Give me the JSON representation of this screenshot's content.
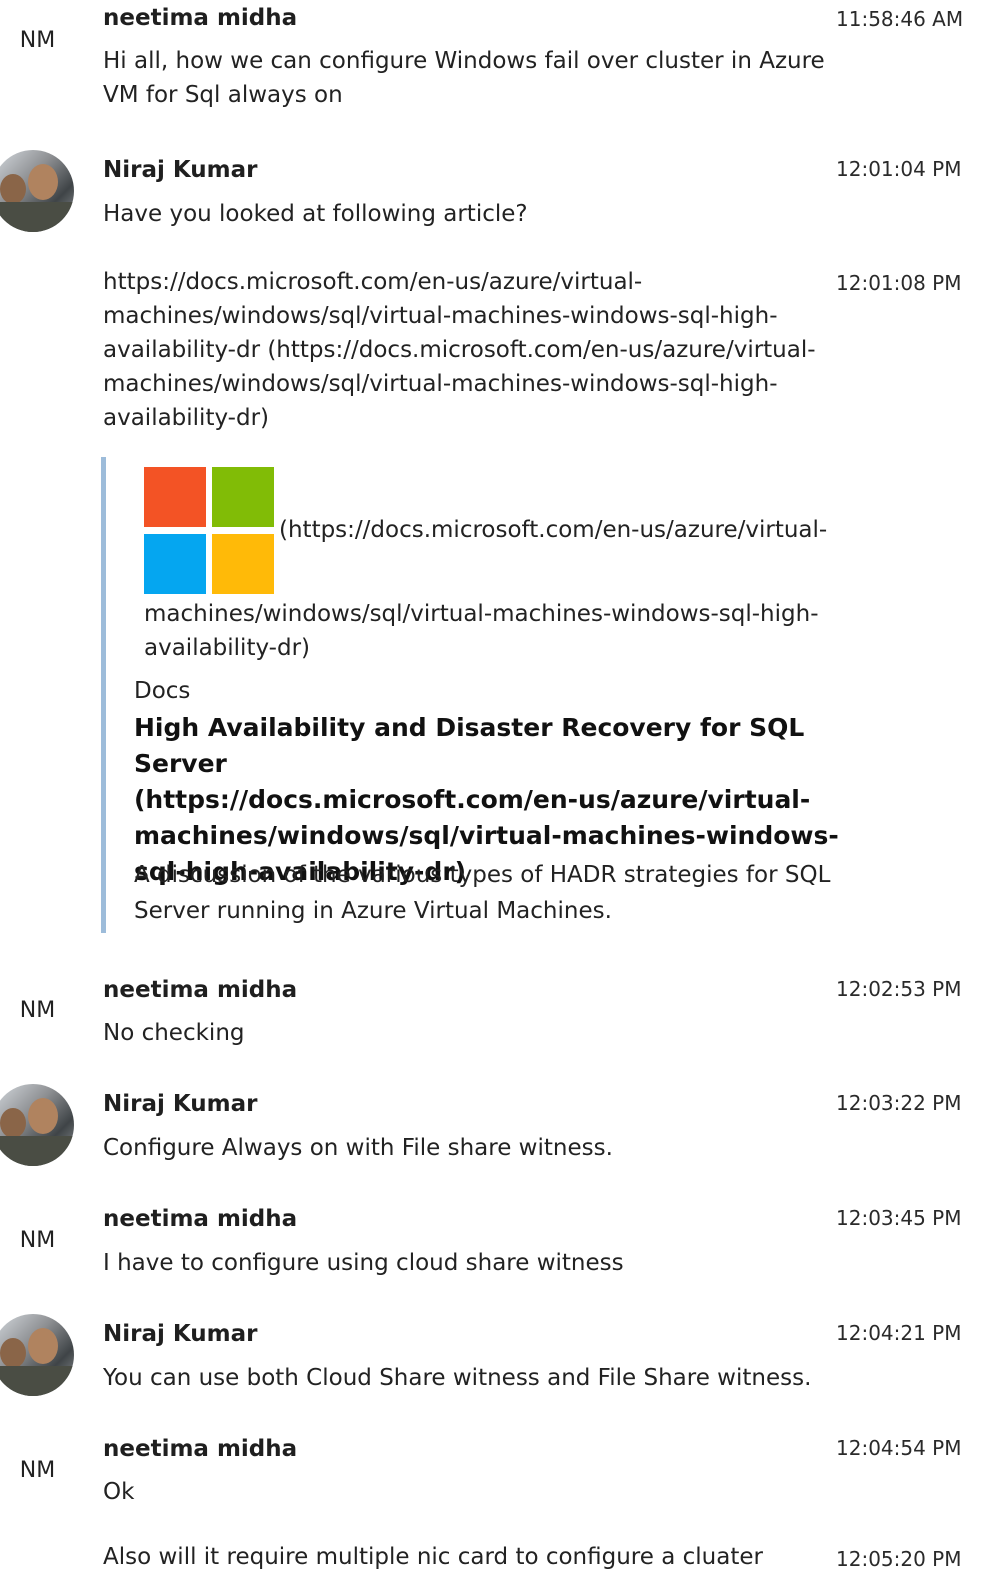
{
  "messages": [
    {
      "sender": "neetima midha",
      "initials": "NM",
      "time": "11:58:46 AM",
      "text": "Hi all,  how we can configure Windows fail over cluster in Azure\nVM for Sql always on"
    },
    {
      "sender": "Niraj Kumar",
      "avatar": "profile-photo",
      "time": "12:01:04 PM",
      "text": "Have you looked at following article?"
    },
    {
      "time": "12:01:08 PM",
      "text": "https://docs.microsoft.com/en-us/azure/virtual-\nmachines/windows/sql/virtual-machines-windows-sql-high-\navailability-dr (https://docs.microsoft.com/en-us/azure/virtual-\nmachines/windows/sql/virtual-machines-windows-sql-high-\navailability-dr)",
      "preview": {
        "logo": "microsoft-logo",
        "logo_colors": [
          "#f35325",
          "#81bc06",
          "#05a6f0",
          "#ffba08"
        ],
        "link_line1": "(https://docs.microsoft.com/en-us/azure/virtual-",
        "link_rest": "machines/windows/sql/virtual-machines-windows-sql-high-\navailability-dr)",
        "source": "Docs",
        "title": "High Availability and Disaster Recovery for SQL Server\n(https://docs.microsoft.com/en-us/azure/virtual-\nmachines/windows/sql/virtual-machines-windows-\nsql-high-availability-dr)",
        "description": "A discussion of the various types of HADR strategies for SQL\nServer running in Azure Virtual Machines."
      }
    },
    {
      "sender": "neetima midha",
      "initials": "NM",
      "time": "12:02:53 PM",
      "text": "No checking"
    },
    {
      "sender": "Niraj Kumar",
      "avatar": "profile-photo",
      "time": "12:03:22 PM",
      "text": "Configure Always on with File share witness."
    },
    {
      "sender": "neetima midha",
      "initials": "NM",
      "time": "12:03:45 PM",
      "text": "I have to configure using cloud share witness"
    },
    {
      "sender": "Niraj Kumar",
      "avatar": "profile-photo",
      "time": "12:04:21 PM",
      "text": "You can use both Cloud Share witness and File Share witness."
    },
    {
      "sender": "neetima midha",
      "initials": "NM",
      "time": "12:04:54 PM",
      "text": "Ok"
    },
    {
      "time": "12:05:20 PM",
      "text": "Also will it require multiple nic card to configure a cluater"
    }
  ]
}
